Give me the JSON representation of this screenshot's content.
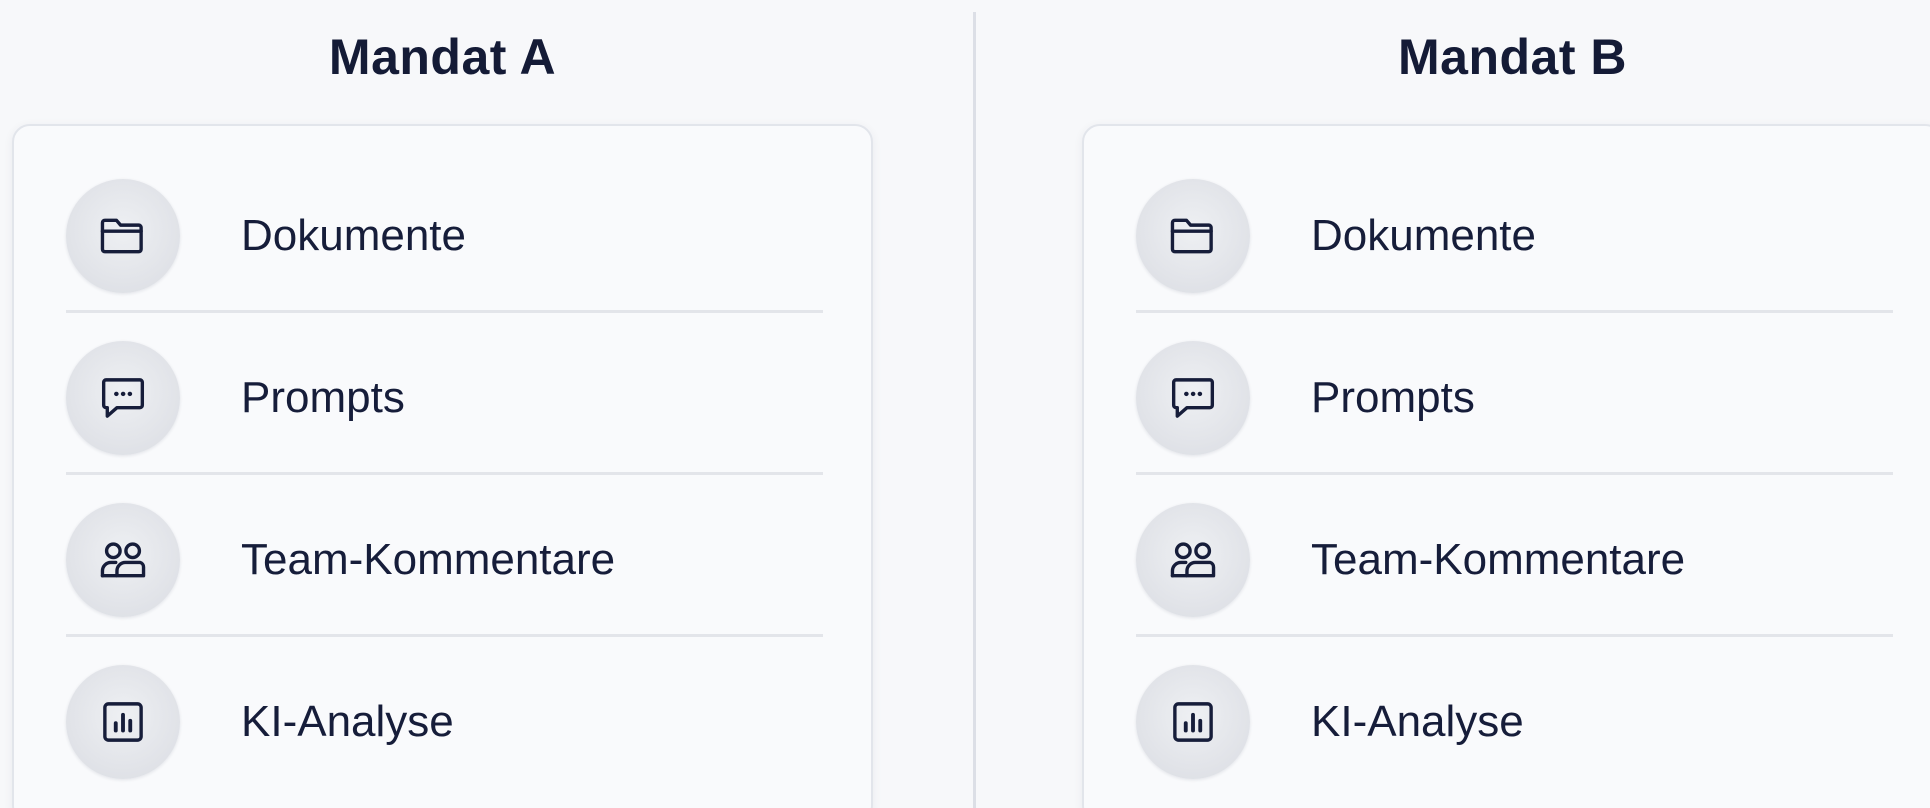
{
  "columns": [
    {
      "title": "Mandat A",
      "items": [
        {
          "label": "Dokumente",
          "icon": "folder-icon"
        },
        {
          "label": "Prompts",
          "icon": "chat-bubble-icon"
        },
        {
          "label": "Team-Kommentare",
          "icon": "users-icon"
        },
        {
          "label": "KI-Analyse",
          "icon": "chart-icon"
        }
      ]
    },
    {
      "title": "Mandat B",
      "items": [
        {
          "label": "Dokumente",
          "icon": "folder-icon"
        },
        {
          "label": "Prompts",
          "icon": "chat-bubble-icon"
        },
        {
          "label": "Team-Kommentare",
          "icon": "users-icon"
        },
        {
          "label": "KI-Analyse",
          "icon": "chart-icon"
        }
      ]
    }
  ],
  "colors": {
    "background": "#f7f8fa",
    "text": "#161d3a",
    "divider": "#dcdfe6",
    "icon_circle": "#e2e4e9"
  }
}
